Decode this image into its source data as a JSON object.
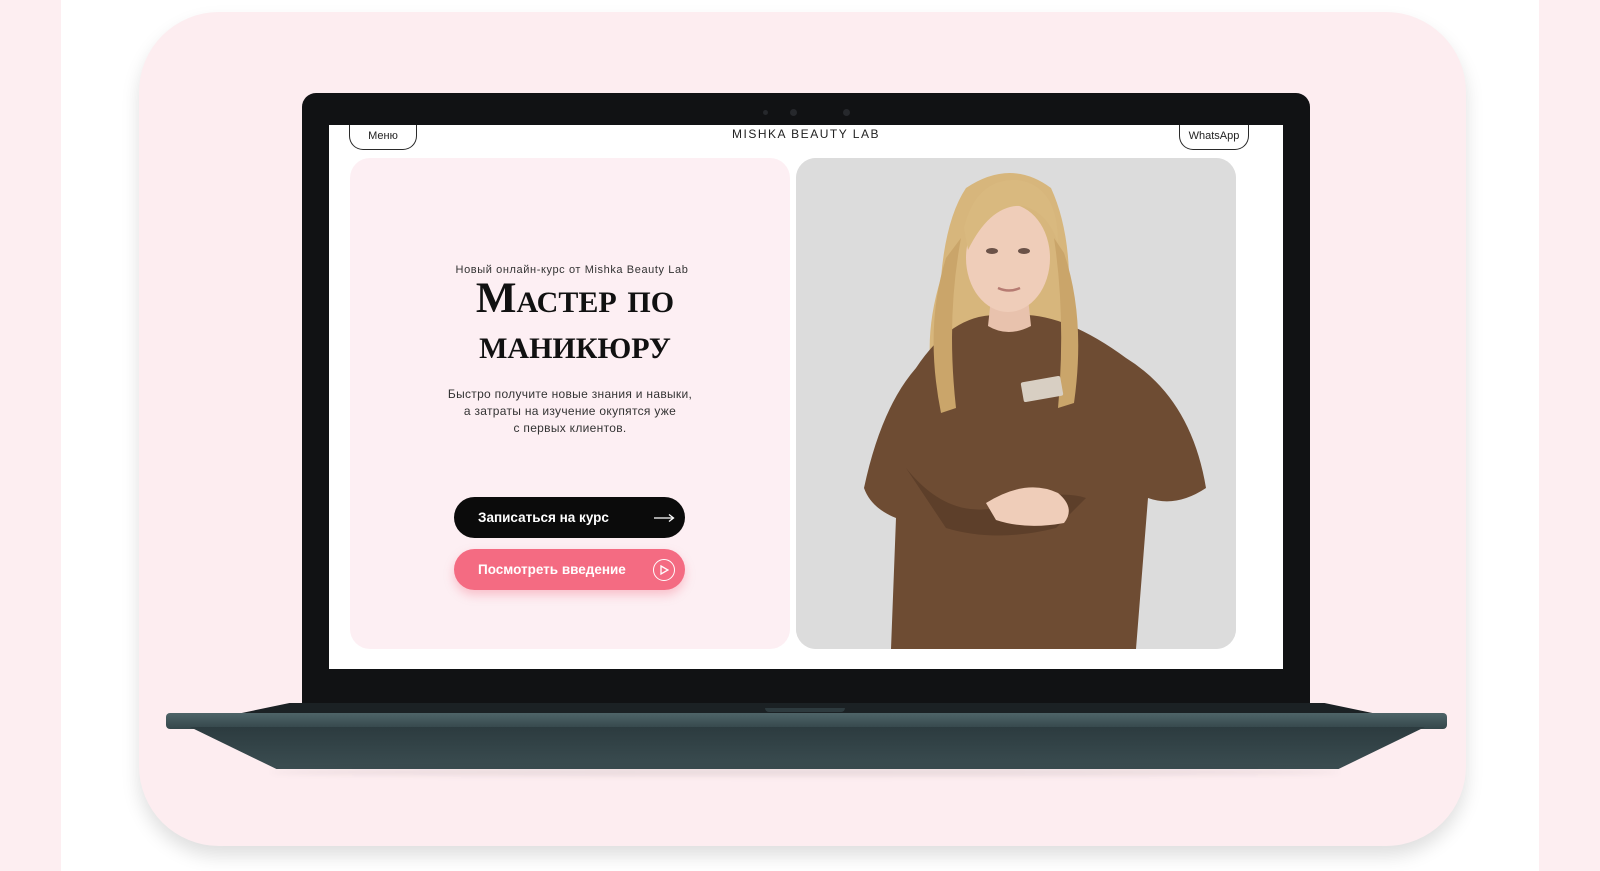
{
  "site": {
    "brand": "MISHKA BEAUTY LAB",
    "menu_label": "Меню",
    "whatsapp_label": "WhatsApp"
  },
  "hero": {
    "subtitle": "Новый онлайн-курс от Mishka Beauty Lab",
    "title_line1": "Мастер по",
    "title_line2": "маникюру",
    "description_line1": "Быстро получите новые знания и навыки,",
    "description_line2": "а затраты на изучение окупятся уже",
    "description_line3": "с первых клиентов.",
    "primary_button": "Записаться на курс",
    "secondary_button": "Посмотреть введение"
  },
  "colors": {
    "page_background": "#fdeef1",
    "card_background": "#fdedf0",
    "primary_button": "#0b0b0b",
    "accent_pink": "#f46b82",
    "photo_background": "#dcdcdc",
    "laptop_base": "#3b4d51"
  },
  "icons": {
    "primary_button": "arrow-right-icon",
    "secondary_button": "play-circle-icon"
  }
}
